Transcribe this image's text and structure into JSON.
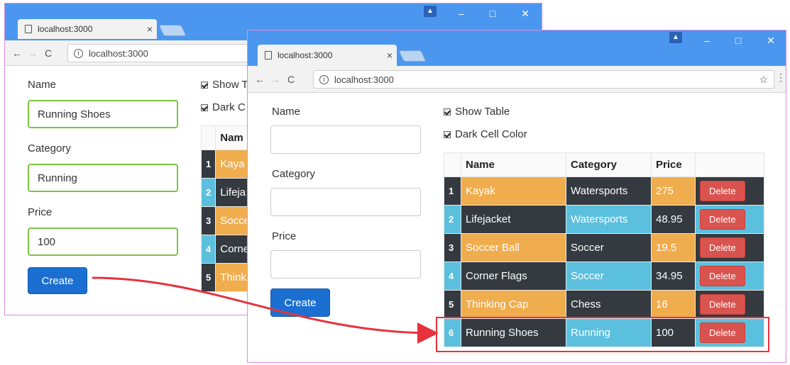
{
  "back_window": {
    "tab_title": "localhost:3000",
    "address": "localhost:3000",
    "form": {
      "name_label": "Name",
      "name_value": "Running Shoes",
      "category_label": "Category",
      "category_value": "Running",
      "price_label": "Price",
      "price_value": "100",
      "create_label": "Create"
    },
    "checkbox_show": "Show T",
    "checkbox_dark": "Dark C",
    "col_name": "Nam",
    "rows": [
      {
        "num": "1",
        "name": "Kaya"
      },
      {
        "num": "2",
        "name": "Lifeja"
      },
      {
        "num": "3",
        "name": "Socce"
      },
      {
        "num": "4",
        "name": "Corne"
      },
      {
        "num": "5",
        "name": "Think"
      }
    ]
  },
  "front_window": {
    "tab_title": "localhost:3000",
    "address": "localhost:3000",
    "form": {
      "name_label": "Name",
      "name_value": "",
      "category_label": "Category",
      "category_value": "",
      "price_label": "Price",
      "price_value": "",
      "create_label": "Create"
    },
    "checkbox_show": "Show Table",
    "checkbox_dark": "Dark Cell Color",
    "columns": [
      "Name",
      "Category",
      "Price",
      ""
    ],
    "delete_label": "Delete",
    "rows": [
      {
        "num": "1",
        "name": "Kayak",
        "category": "Watersports",
        "price": "275"
      },
      {
        "num": "2",
        "name": "Lifejacket",
        "category": "Watersports",
        "price": "48.95"
      },
      {
        "num": "3",
        "name": "Soccer Ball",
        "category": "Soccer",
        "price": "19.5"
      },
      {
        "num": "4",
        "name": "Corner Flags",
        "category": "Soccer",
        "price": "34.95"
      },
      {
        "num": "5",
        "name": "Thinking Cap",
        "category": "Chess",
        "price": "16"
      },
      {
        "num": "6",
        "name": "Running Shoes",
        "category": "Running",
        "price": "100"
      }
    ]
  },
  "window_controls": {
    "minimize": "–",
    "maximize": "□",
    "close": "✕"
  },
  "colors": {
    "titlebar": "#4b97ef",
    "dark_cell": "#343a40",
    "orange_cell": "#f0ad4e",
    "blue_cell": "#5bc0de",
    "delete_button": "#d9534f",
    "create_button": "#1b6fd1",
    "valid_border": "#7bc443",
    "annotation": "#e6333e"
  }
}
